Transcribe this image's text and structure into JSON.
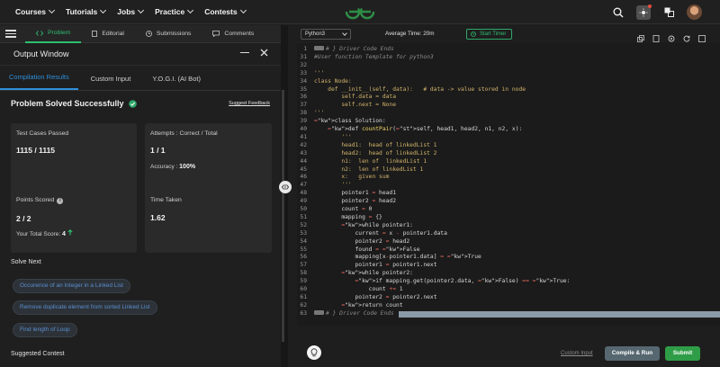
{
  "nav": {
    "items": [
      {
        "label": "Courses"
      },
      {
        "label": "Tutorials"
      },
      {
        "label": "Jobs"
      },
      {
        "label": "Practice"
      },
      {
        "label": "Contests"
      }
    ],
    "icons": [
      "search-icon",
      "theme-toggle-icon",
      "translate-icon",
      "avatar"
    ],
    "accent": "#2f8d46"
  },
  "problem_tabs": [
    {
      "label": "Problem",
      "icon": "code-icon"
    },
    {
      "label": "Editorial",
      "icon": "document-icon"
    },
    {
      "label": "Submissions",
      "icon": "history-icon"
    },
    {
      "label": "Comments",
      "icon": "comment-icon"
    }
  ],
  "output": {
    "title": "Output Window",
    "tabs": [
      "Compilation Results",
      "Custom Input",
      "Y.O.G.I. (AI Bot)"
    ],
    "status": "Problem Solved Successfully",
    "feedback": "Suggest Feedback",
    "test_cases_label": "Test Cases Passed",
    "test_cases_value": "1115 / 1115",
    "attempts_label": "Attempts : Correct / Total",
    "attempts_value": "1 / 1",
    "accuracy_label": "Accuracy :",
    "accuracy_value": "100%",
    "points_label": "Points Scored",
    "points_value": "2 / 2",
    "total_score_label": "Your Total Score:",
    "total_score_value": "4",
    "time_label": "Time Taken",
    "time_value": "1.62",
    "solve_next_title": "Solve Next",
    "solve_next": [
      "Occurence of an Integer in a Linked List",
      "Remove duplicate element from sorted Linked List",
      "Find length of Loop"
    ],
    "suggested_contest_title": "Suggested Contest"
  },
  "editor": {
    "language": "Python3",
    "avg_time": "Average Time: 20m",
    "timer_label": "Start Timer",
    "custom_input": "Custom Input",
    "compile_run": "Compile & Run",
    "submit": "Submit",
    "lines": [
      {
        "n": "1",
        "text": "# } Driver Code Ends"
      },
      {
        "n": "31",
        "text": "#User function Template for python3"
      },
      {
        "n": "32",
        "text": ""
      },
      {
        "n": "33",
        "text": "'''"
      },
      {
        "n": "34",
        "text": "class Node:"
      },
      {
        "n": "35",
        "text": "    def __init__(self, data):   # data -> value stored in node"
      },
      {
        "n": "36",
        "text": "        self.data = data"
      },
      {
        "n": "37",
        "text": "        self.next = None"
      },
      {
        "n": "38",
        "text": "'''"
      },
      {
        "n": "39",
        "text": "class Solution:"
      },
      {
        "n": "40",
        "text": "    def countPair(self, head1, head2, n1, n2, x):"
      },
      {
        "n": "41",
        "text": "        '''"
      },
      {
        "n": "42",
        "text": "        head1:  head of linkedList 1"
      },
      {
        "n": "43",
        "text": "        head2:  head of linkedList 2"
      },
      {
        "n": "44",
        "text": "        n1:  len of  linkedList 1"
      },
      {
        "n": "45",
        "text": "        n2:  len of linkedList 1"
      },
      {
        "n": "46",
        "text": "        x:   given sum"
      },
      {
        "n": "47",
        "text": "        '''"
      },
      {
        "n": "48",
        "text": "        pointer1 = head1"
      },
      {
        "n": "49",
        "text": "        pointer2 = head2"
      },
      {
        "n": "50",
        "text": "        count = 0"
      },
      {
        "n": "51",
        "text": "        mapping = {}"
      },
      {
        "n": "52",
        "text": "        while pointer1:"
      },
      {
        "n": "53",
        "text": "            current = x - pointer1.data"
      },
      {
        "n": "54",
        "text": "            pointer2 = head2"
      },
      {
        "n": "55",
        "text": "            found = False"
      },
      {
        "n": "56",
        "text": "            mapping[x-pointer1.data] = True"
      },
      {
        "n": "57",
        "text": "            pointer1 = pointer1.next"
      },
      {
        "n": "58",
        "text": "        while pointer2:"
      },
      {
        "n": "59",
        "text": "            if mapping.get(pointer2.data, False) == True:"
      },
      {
        "n": "60",
        "text": "                count += 1"
      },
      {
        "n": "61",
        "text": "            pointer2 = pointer2.next"
      },
      {
        "n": "62",
        "text": "        return count"
      },
      {
        "n": "63",
        "text": "# } Driver Code Ends"
      }
    ]
  }
}
